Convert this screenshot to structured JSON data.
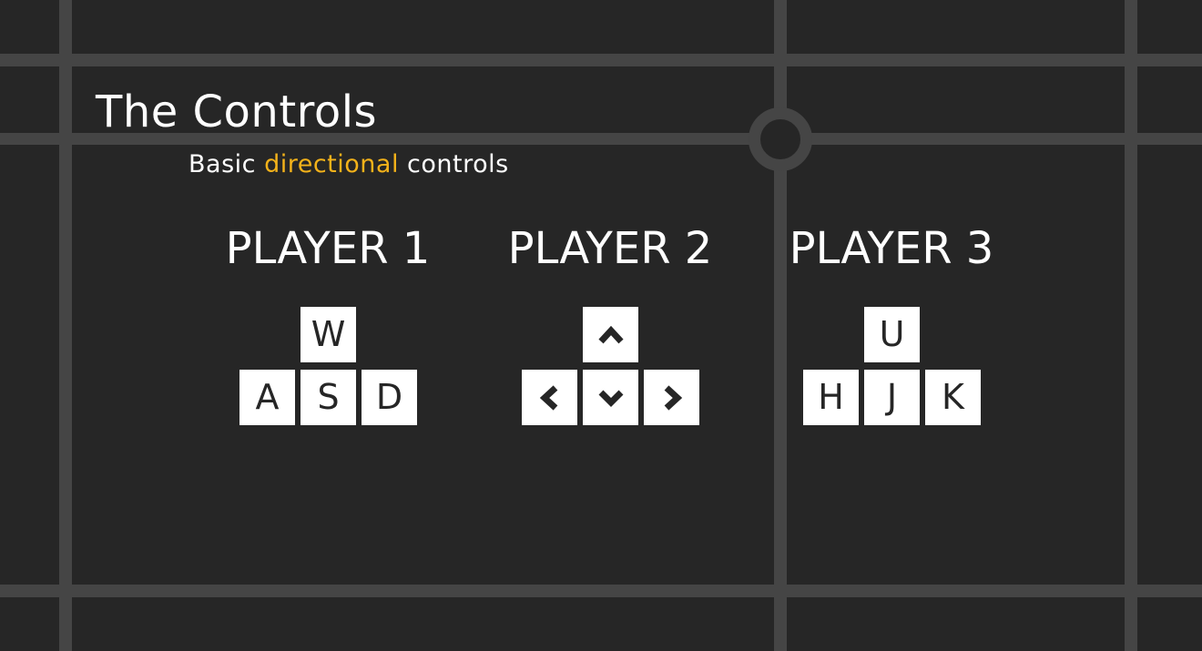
{
  "title": "The Controls",
  "subtitle": {
    "before": "Basic",
    "accent": "directional",
    "after": "controls"
  },
  "colors": {
    "background": "#262626",
    "grid": "#454545",
    "accent": "#f3b21a",
    "key": "#ffffff",
    "text": "#ffffff"
  },
  "players": [
    {
      "name": "PLAYER 1",
      "keys": {
        "up": "W",
        "left": "A",
        "down": "S",
        "right": "D"
      }
    },
    {
      "name": "PLAYER 2",
      "keys": {
        "up": "arrow-up-icon",
        "left": "arrow-left-icon",
        "down": "arrow-down-icon",
        "right": "arrow-right-icon"
      }
    },
    {
      "name": "PLAYER 3",
      "keys": {
        "up": "U",
        "left": "H",
        "down": "J",
        "right": "K"
      }
    }
  ]
}
